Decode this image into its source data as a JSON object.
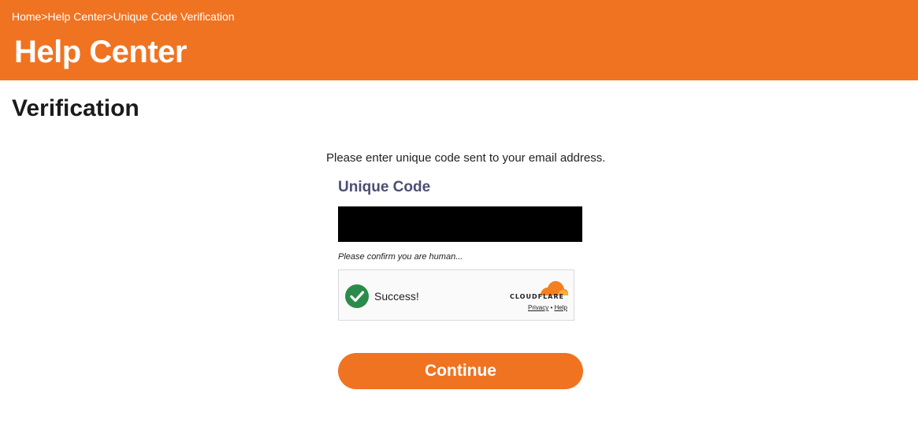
{
  "breadcrumb": {
    "items": [
      "Home",
      "Help Center",
      "Unique Code Verification"
    ],
    "separator": ">"
  },
  "header": {
    "title": "Help Center",
    "background_color": "#f07321"
  },
  "page": {
    "title": "Verification"
  },
  "form": {
    "instruction": "Please enter unique code sent to your email address.",
    "code_label": "Unique Code",
    "code_value": "",
    "human_note": "Please confirm you are human...",
    "continue_label": "Continue",
    "button_color": "#f07321",
    "label_color": "#4b4f73"
  },
  "captcha": {
    "status": "Success!",
    "status_icon": "check-circle-icon",
    "status_color": "#2a8c4a",
    "provider": "CLOUDFLARE",
    "provider_icon": "cloudflare-cloud-icon",
    "privacy_label": "Privacy",
    "link_separator": "•",
    "help_label": "Help"
  }
}
